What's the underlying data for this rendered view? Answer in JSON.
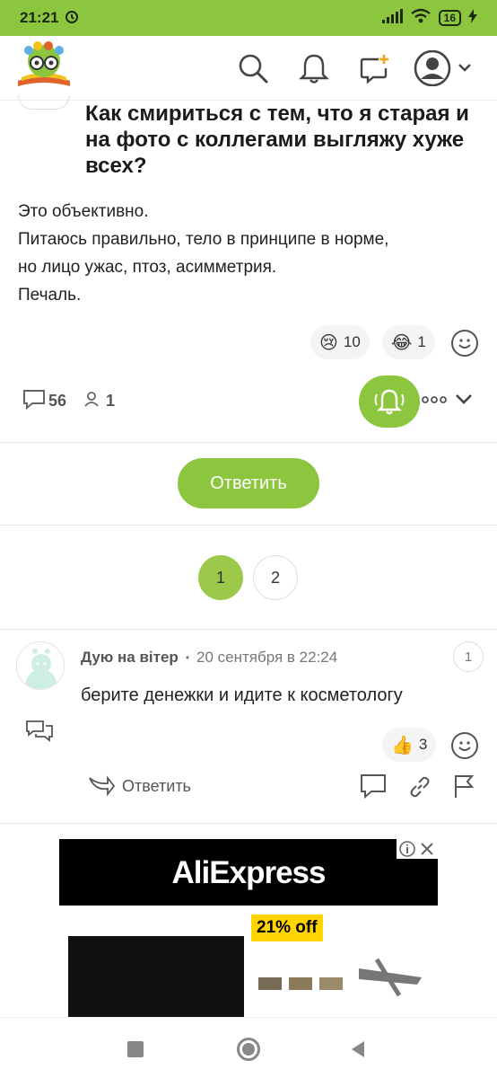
{
  "status": {
    "time": "21:21",
    "battery": "16"
  },
  "header": {
    "logo_name": "site-logo",
    "icons": [
      "search-icon",
      "bell-icon",
      "new-post-icon",
      "profile-icon"
    ]
  },
  "post": {
    "title": "Как смириться с тем, что я старая и на фото с коллегами выгляжу хуже всех?",
    "body": [
      "Это объективно.",
      "Питаюсь правильно, тело в принципе в норме,",
      "но лицо ужас, птоз, асимметрия.",
      "Печаль."
    ],
    "reactions": [
      {
        "emoji": "😢",
        "count": "10"
      },
      {
        "emoji": "😂",
        "count": "1"
      }
    ],
    "comments_count": "56",
    "subscribers_count": "1",
    "reply_label": "Ответить"
  },
  "pagination": {
    "pages": [
      "1",
      "2"
    ],
    "current": "1"
  },
  "comment": {
    "author": "Дую на вітер",
    "separator": "•",
    "date": "20 сентября в 22:24",
    "number": "1",
    "text": "берите денежки и идите к косметологу",
    "reaction": {
      "emoji": "👍",
      "count": "3"
    },
    "reply_label": "Ответить"
  },
  "ad": {
    "brand": "AliExpress",
    "badge": "21% off"
  },
  "colors": {
    "accent": "#8cc63f"
  }
}
